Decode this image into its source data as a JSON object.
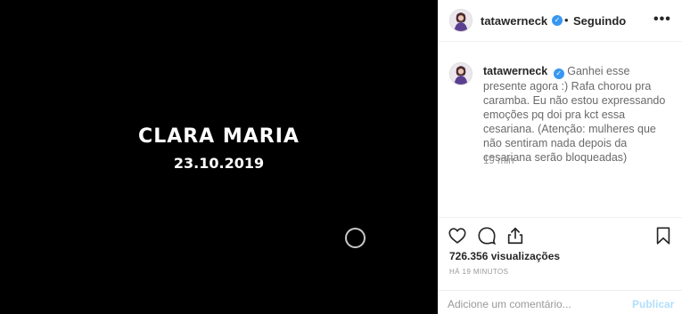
{
  "media": {
    "title": "CLARA MARIA",
    "date": "23.10.2019",
    "play_icon": "play-circle-icon"
  },
  "header": {
    "username": "tatawerneck",
    "separator": "•",
    "follow_status": "Seguindo",
    "more": "•••"
  },
  "caption": {
    "username": "tatawerneck",
    "text": "Ganhei esse presente agora :) Rafa chorou pra caramba. Eu não estou expressando emoções pq doi pra kct essa cesariana. (Atenção: mulheres que não sentiram nada depois da cesariana serão bloqueadas)",
    "time": "19 min"
  },
  "actions": {
    "icons": [
      "heart-icon",
      "comment-icon",
      "share-icon",
      "bookmark-icon"
    ]
  },
  "stats": {
    "views": "726.356 visualizações",
    "posted": "HÁ 19 MINUTOS"
  },
  "add_comment": {
    "placeholder": "Adicione um comentário...",
    "publish_label": "Publicar"
  },
  "colors": {
    "verified": "#3897f0",
    "publish_disabled": "#b2dffc",
    "media_bg": "#000000"
  }
}
